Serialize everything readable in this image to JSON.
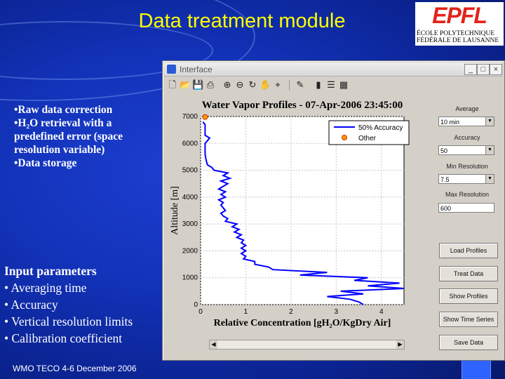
{
  "slide": {
    "title": "Data treatment module",
    "logo": {
      "mark": "EPFL",
      "line1": "ÉCOLE POLYTECHNIQUE",
      "line2": "FÉDÉRALE DE LAUSANNE"
    },
    "bullets_top": [
      "•Raw data correction",
      "•H₂O retrieval with a predefined error (space resolution variable)",
      "•Data storage"
    ],
    "params_heading": "Input parameters",
    "bullets_params": [
      "• Averaging time",
      "• Accuracy",
      "• Vertical resolution limits",
      "• Calibration coefficient"
    ],
    "footer": "WMO TECO 4-6 December 2006"
  },
  "window": {
    "title": "Interface",
    "toolbar_icons": [
      "new-file-icon",
      "open-folder-icon",
      "save-icon",
      "print-icon",
      "zoom-in-icon",
      "zoom-out-icon",
      "rotate-icon",
      "pan-icon",
      "data-cursor-icon",
      "brush-icon",
      "colorbar-icon",
      "legend-icon",
      "plot-tools-icon"
    ],
    "panel": {
      "average_label": "Average",
      "average_value": "10 min",
      "accuracy_label": "Accuracy",
      "accuracy_value": "50",
      "min_res_label": "Min Resolution",
      "min_res_value": "7.5",
      "max_res_label": "Max Resolution",
      "max_res_value": "600",
      "buttons": [
        "Load Profiles",
        "Treat Data",
        "Show Profiles",
        "Show Time Series",
        "Save Data"
      ]
    }
  },
  "chart_data": {
    "type": "line",
    "title": "Water Vapor Profiles - 07-Apr-2006 23:45:00",
    "xlabel": "Relative Concentration [gH₂O/KgDry Air]",
    "ylabel": "Altitude [m]",
    "xlim": [
      0,
      4.5
    ],
    "ylim": [
      0,
      7000
    ],
    "xticks": [
      "0",
      "1",
      "2",
      "3",
      "4"
    ],
    "yticks": [
      "0",
      "1000",
      "2000",
      "3000",
      "4000",
      "5000",
      "6000",
      "7000"
    ],
    "legend": [
      "50% Accuracy",
      "Other"
    ],
    "legend_position": "top-right",
    "series": [
      {
        "name": "50% Accuracy",
        "color": "#0000ff",
        "points": [
          [
            3.6,
            0
          ],
          [
            3.5,
            100
          ],
          [
            3.3,
            200
          ],
          [
            2.8,
            300
          ],
          [
            3.6,
            400
          ],
          [
            3.1,
            500
          ],
          [
            4.5,
            600
          ],
          [
            3.7,
            700
          ],
          [
            4.4,
            800
          ],
          [
            3.4,
            900
          ],
          [
            3.7,
            1000
          ],
          [
            2.2,
            1100
          ],
          [
            2.8,
            1200
          ],
          [
            1.6,
            1300
          ],
          [
            1.5,
            1400
          ],
          [
            1.2,
            1500
          ],
          [
            1.2,
            1600
          ],
          [
            0.95,
            1700
          ],
          [
            1.0,
            1800
          ],
          [
            0.9,
            1900
          ],
          [
            1.0,
            2000
          ],
          [
            0.9,
            2100
          ],
          [
            1.0,
            2200
          ],
          [
            0.9,
            2300
          ],
          [
            0.95,
            2400
          ],
          [
            0.8,
            2500
          ],
          [
            0.9,
            2600
          ],
          [
            0.75,
            2700
          ],
          [
            0.85,
            2800
          ],
          [
            0.7,
            2900
          ],
          [
            0.8,
            3000
          ],
          [
            0.55,
            3100
          ],
          [
            0.6,
            3200
          ],
          [
            0.5,
            3300
          ],
          [
            0.45,
            3400
          ],
          [
            0.55,
            3500
          ],
          [
            0.5,
            3600
          ],
          [
            0.45,
            3700
          ],
          [
            0.5,
            3800
          ],
          [
            0.4,
            3900
          ],
          [
            0.55,
            4000
          ],
          [
            0.45,
            4100
          ],
          [
            0.55,
            4200
          ],
          [
            0.4,
            4300
          ],
          [
            0.5,
            4400
          ],
          [
            0.6,
            4500
          ],
          [
            0.45,
            4600
          ],
          [
            0.65,
            4700
          ],
          [
            0.5,
            4800
          ],
          [
            0.6,
            4900
          ],
          [
            0.3,
            5000
          ],
          [
            0.25,
            5100
          ],
          [
            0.15,
            5200
          ],
          [
            0.12,
            5400
          ],
          [
            0.1,
            5600
          ],
          [
            0.1,
            5800
          ],
          [
            0.1,
            6000
          ],
          [
            0.15,
            6100
          ],
          [
            0.2,
            6200
          ],
          [
            0.1,
            6300
          ],
          [
            0.1,
            6500
          ],
          [
            0.1,
            6700
          ],
          [
            0.05,
            6800
          ]
        ]
      },
      {
        "name": "Other",
        "color": "#ff9900",
        "points": [
          [
            0.1,
            6980
          ]
        ]
      }
    ]
  }
}
